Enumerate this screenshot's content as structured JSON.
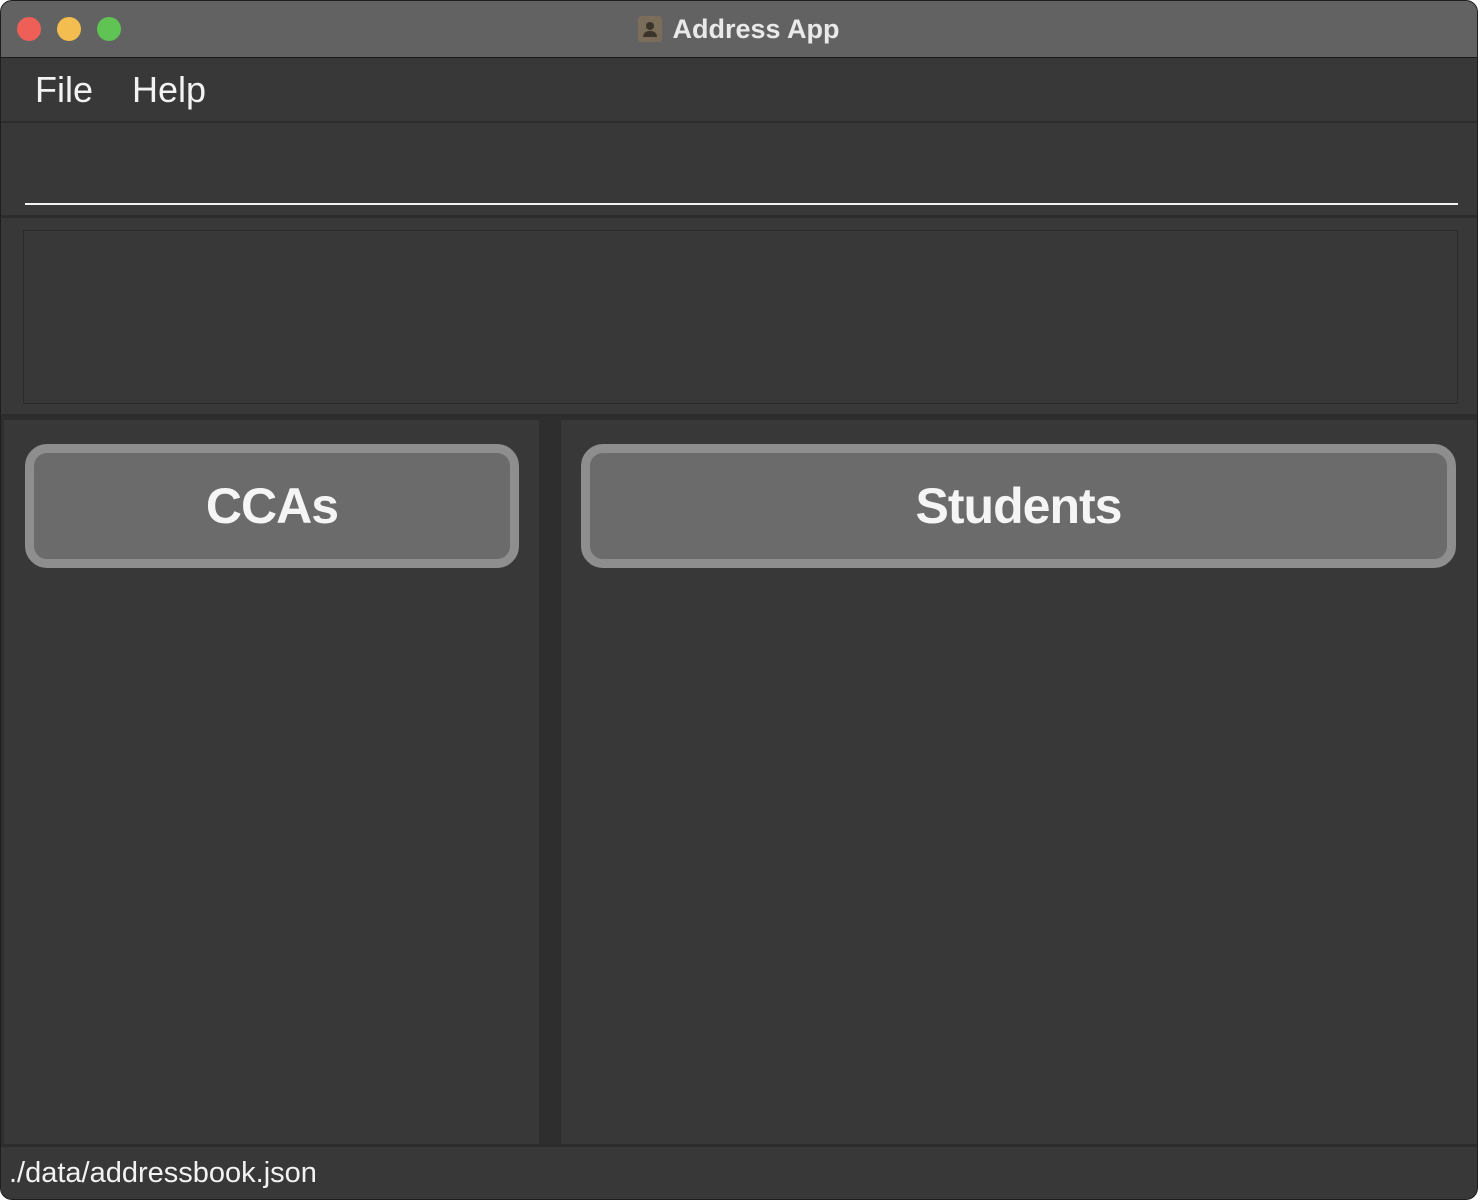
{
  "window": {
    "title": "Address App",
    "controls": {
      "close_icon": "close-button",
      "minimize_icon": "minimize-button",
      "zoom_icon": "zoom-button"
    },
    "app_icon": "contacts-icon"
  },
  "menubar": {
    "items": [
      {
        "label": "File"
      },
      {
        "label": "Help"
      }
    ]
  },
  "command_box": {
    "value": "",
    "placeholder": ""
  },
  "result_display": {
    "text": ""
  },
  "panels": {
    "left": {
      "button_label": "CCAs"
    },
    "right": {
      "button_label": "Students"
    }
  },
  "status_bar": {
    "path": "./data/addressbook.json"
  },
  "colors": {
    "titlebar": "#626262",
    "background": "#383838",
    "button": "#6b6b6b",
    "button_border": "#8e8e8e",
    "traffic_close": "#ee5f57",
    "traffic_minimize": "#f4bd4f",
    "traffic_zoom": "#60c455"
  }
}
